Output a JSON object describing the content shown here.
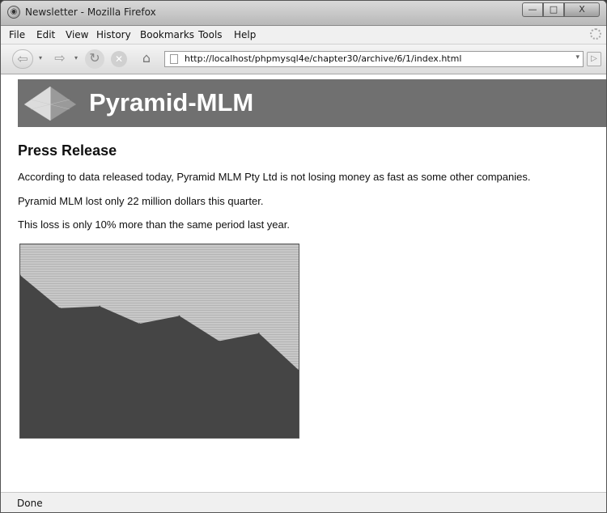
{
  "window": {
    "title": "Newsletter - Mozilla Firefox",
    "min": "—",
    "max": "□",
    "close": "X"
  },
  "menu": {
    "file": "File",
    "edit": "Edit",
    "view": "View",
    "history": "History",
    "bookmarks": "Bookmarks",
    "tools": "Tools",
    "help": "Help"
  },
  "nav": {
    "url": "http://localhost/phpmysql4e/chapter30/archive/6/1/index.html"
  },
  "page": {
    "banner_title": "Pyramid-MLM",
    "heading": "Press Release",
    "paragraphs": [
      "According to data released today, Pyramid MLM Pty Ltd is not losing money as fast as some other companies.",
      "Pyramid MLM lost only 22 million dollars this quarter.",
      "This loss is only 10% more than the same period last year."
    ]
  },
  "chart_data": {
    "type": "area",
    "x": [
      1,
      2,
      3,
      4,
      5,
      6,
      7,
      8
    ],
    "values": [
      84,
      67,
      68,
      59,
      63,
      50,
      54,
      35
    ],
    "ylim": [
      0,
      100
    ],
    "colors": {
      "area": "#454545",
      "background": "#c4c4c4"
    }
  },
  "status": {
    "text": "Done"
  },
  "colors": {
    "banner": "#707070",
    "banner_text": "#ffffff"
  }
}
